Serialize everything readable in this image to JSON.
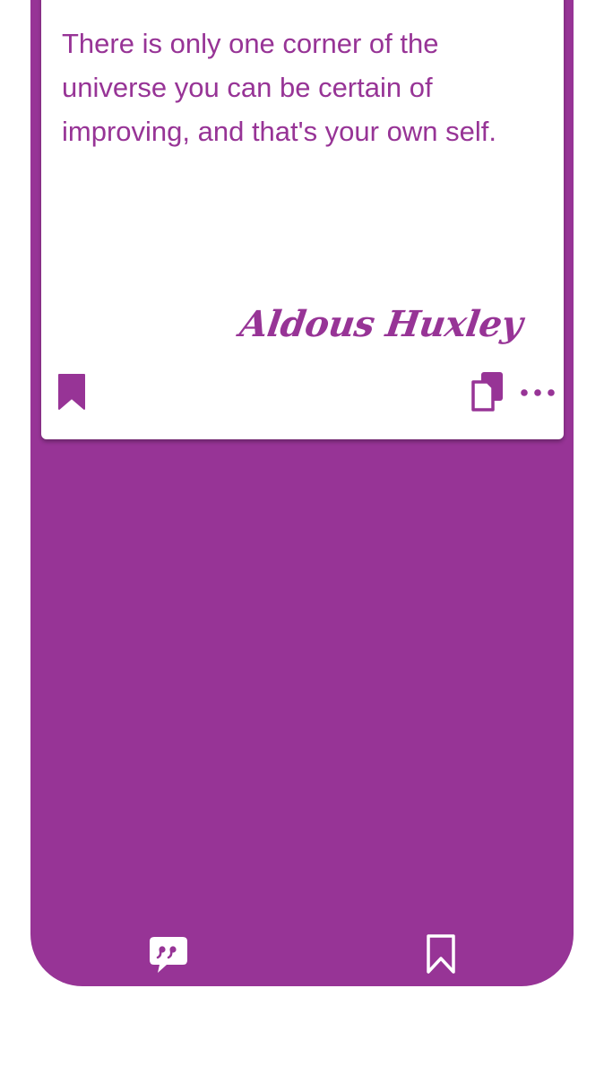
{
  "quote": {
    "text": "There is only one corner of the universe you can be certain of improving, and that's your own self.",
    "author": "Aldous Huxley"
  },
  "card_actions": {
    "bookmark_icon": "bookmark-filled-icon",
    "copy_icon": "copy-icon",
    "more_icon": "more-horizontal-icon"
  },
  "bottom_nav": {
    "items": [
      {
        "icon": "quote-bubble-icon"
      },
      {
        "icon": "bookmark-outline-icon"
      }
    ]
  },
  "colors": {
    "accent": "#973496",
    "card_background": "#ffffff",
    "page_background": "#ffffff"
  }
}
